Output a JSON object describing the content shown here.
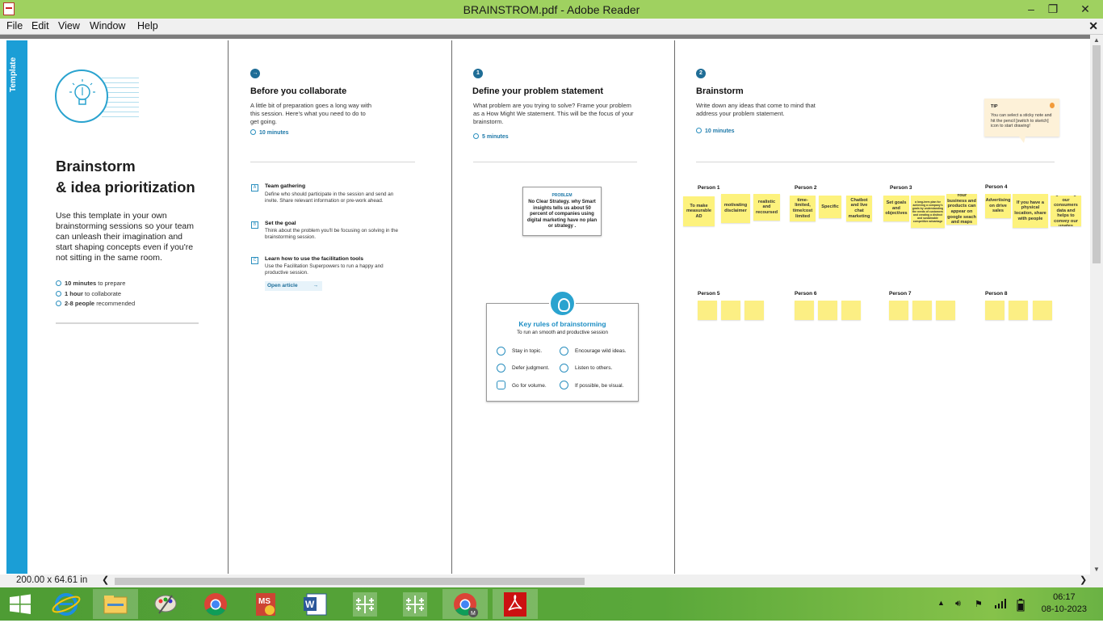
{
  "window": {
    "title": "BRAINSTROM.pdf - Adobe Reader"
  },
  "menu": {
    "items": [
      "File",
      "Edit",
      "View",
      "Window",
      "Help"
    ]
  },
  "status": {
    "page_size": "200.00 x 64.61 in"
  },
  "template_tab": "Template",
  "intro": {
    "title_line1": "Brainstorm",
    "title_line2": "& idea prioritization",
    "description": "Use this template in your own brainstorming sessions so your team can unleash their imagination and start shaping concepts even if you're not sitting in the same room.",
    "meta": [
      {
        "bold": "10 minutes",
        "rest": "to prepare"
      },
      {
        "bold": "1 hour",
        "rest": "to collaborate"
      },
      {
        "bold": "2-8 people",
        "rest": "recommended"
      }
    ]
  },
  "before": {
    "title": "Before you collaborate",
    "description": "A little bit of preparation goes a long way with this session. Here's what you need to do to get going.",
    "time": "10 minutes",
    "tasks": [
      {
        "icon": "A",
        "title": "Team gathering",
        "desc": "Define who should participate in the session and send an invite. Share relevant information or pre-work ahead."
      },
      {
        "icon": "B",
        "title": "Set the goal",
        "desc": "Think about the problem you'll be focusing on solving in the brainstorming session."
      },
      {
        "icon": "C",
        "title": "Learn how to use the facilitation tools",
        "desc": "Use the Facilitation Superpowers to run a happy and productive session."
      }
    ],
    "open_article": "Open article"
  },
  "define": {
    "step": "1",
    "title": "Define your problem statement",
    "description": "What problem are you trying to solve? Frame your problem as a How Might We statement. This will be the focus of your brainstorm.",
    "time": "5 minutes",
    "problem_label": "PROBLEM",
    "problem_text": "No Clear Strategy. why Smart insights tells us about 50 percent of companies using digital marketing have no plan or strategy ."
  },
  "rules": {
    "title": "Key rules of brainstorming",
    "subtitle": "To run an smooth and productive session",
    "items": [
      "Stay in topic.",
      "Encourage wild ideas.",
      "Defer judgment.",
      "Listen to others.",
      "Go for volume.",
      "If possible, be visual."
    ]
  },
  "brainstorm": {
    "step": "2",
    "title": "Brainstorm",
    "description": "Write down any ideas that come to mind that address your problem statement.",
    "time": "10 minutes",
    "tip_label": "TIP",
    "tip_text": "You can select a sticky note and hit the pencil [switch to sketch] icon to start drawing!",
    "persons": [
      {
        "name": "Person 1",
        "notes": [
          "To make measurable AD",
          "motivating disclaimer",
          "realistic and recoursed"
        ]
      },
      {
        "name": "Person 2",
        "notes": [
          "time-limited, time/cost limited",
          "Specific",
          "Chatbot and live chat marketing"
        ]
      },
      {
        "name": "Person 3",
        "notes": [
          "Set goals and objectives",
          "a long-term plan for achieving a company's goals by understanding the needs of customers and creating a distinct and sustainable competitive advantage",
          "Your business and products can appear on google seach and maps"
        ]
      },
      {
        "name": "Person 4",
        "notes": [
          "Advertising on drive sales",
          "If you have a physical location, share with people",
          "gathering our consumers data and helps to convey our upates"
        ]
      },
      {
        "name": "Person 5",
        "notes": [
          "",
          "",
          ""
        ]
      },
      {
        "name": "Person 6",
        "notes": [
          "",
          "",
          ""
        ]
      },
      {
        "name": "Person 7",
        "notes": [
          "",
          "",
          ""
        ]
      },
      {
        "name": "Person 8",
        "notes": [
          "",
          "",
          ""
        ]
      }
    ]
  },
  "taskbar": {
    "apps": [
      "start-icon",
      "internet-explorer-icon",
      "file-explorer-icon",
      "paint-icon",
      "chrome-icon",
      "ms-project-icon",
      "word-icon",
      "tableau-icon",
      "tableau-icon",
      "chrome-profile-icon",
      "adobe-reader-icon"
    ],
    "time": "06:17",
    "date": "08-10-2023"
  },
  "colors": {
    "titlebar": "#9fd160",
    "accent": "#1b9ed6",
    "sticky": "#fdf27d",
    "taskbar": "#5aa83a"
  }
}
